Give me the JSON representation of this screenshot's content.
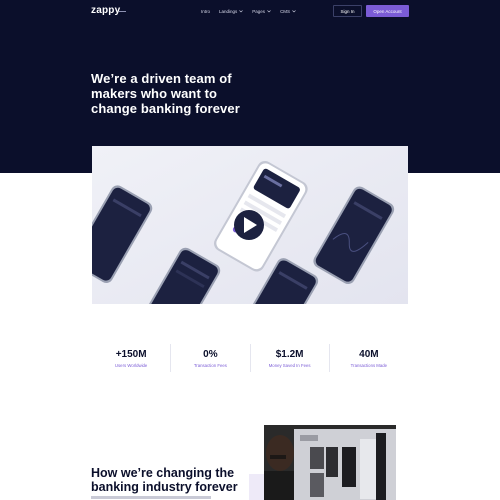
{
  "brand": {
    "logo_text": "zappy"
  },
  "nav": {
    "items": [
      {
        "label": "Intro"
      },
      {
        "label": "Landings"
      },
      {
        "label": "Pages"
      },
      {
        "label": "CMS"
      }
    ],
    "signin_label": "Sign In",
    "open_account_label": "Open Account"
  },
  "hero": {
    "title": "We’re a driven team of makers who want to change banking forever"
  },
  "stats": [
    {
      "value": "+150M",
      "label": "Users Worldwide"
    },
    {
      "value": "0%",
      "label": "Transaction Fees"
    },
    {
      "value": "$1.2M",
      "label": "Money Saved In Fees"
    },
    {
      "value": "40M",
      "label": "Transactions Made"
    }
  ],
  "section": {
    "title": "How we’re changing the banking industry forever"
  },
  "colors": {
    "hero_bg": "#0b0f2b",
    "accent": "#7b5cd6",
    "text_dark": "#0b0f2b"
  },
  "icons": [
    "chevron-down-icon",
    "play-icon"
  ]
}
